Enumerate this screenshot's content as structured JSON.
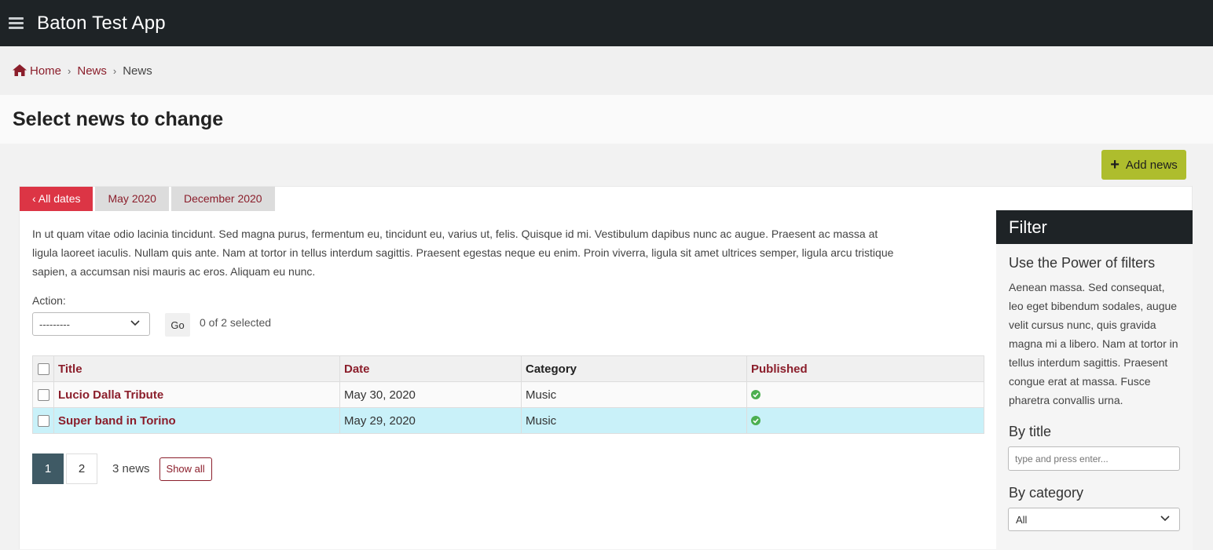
{
  "app": {
    "title": "Baton Test App"
  },
  "breadcrumbs": [
    {
      "label": "Home",
      "icon": "home-icon"
    },
    {
      "label": "News"
    },
    {
      "label": "News"
    }
  ],
  "page": {
    "title": "Select news to change"
  },
  "toolbar": {
    "add_label": "Add news"
  },
  "date_tabs": [
    {
      "label": "‹ All dates",
      "active": true
    },
    {
      "label": "May 2020",
      "active": false
    },
    {
      "label": "December 2020",
      "active": false
    }
  ],
  "description": "In ut quam vitae odio lacinia tincidunt. Sed magna purus, fermentum eu, tincidunt eu, varius ut, felis. Quisque id mi. Vestibulum dapibus nunc ac augue. Praesent ac massa at ligula laoreet iaculis. Nullam quis ante. Nam at tortor in tellus interdum sagittis. Praesent egestas neque eu enim. Proin viverra, ligula sit amet ultrices semper, ligula arcu tristique sapien, a accumsan nisi mauris ac eros. Aliquam eu nunc.",
  "actions": {
    "label": "Action:",
    "selected": "---------",
    "go_label": "Go",
    "selection_count": "0 of 2 selected"
  },
  "table": {
    "columns": [
      "Title",
      "Date",
      "Category",
      "Published"
    ],
    "rows": [
      {
        "title": "Lucio Dalla Tribute",
        "date": "May 30, 2020",
        "category": "Music",
        "published": true
      },
      {
        "title": "Super band in Torino",
        "date": "May 29, 2020",
        "category": "Music",
        "published": true
      }
    ]
  },
  "pagination": {
    "pages": [
      "1",
      "2"
    ],
    "current": "1",
    "count": "3 news",
    "show_all": "Show all"
  },
  "filter": {
    "title": "Filter",
    "subtitle": "Use the Power of filters",
    "text": "Aenean massa. Sed consequat, leo eget bibendum sodales, augue velit cursus nunc, quis gravida magna mi a libero. Nam at tortor in tellus interdum sagittis. Praesent congue erat at massa. Fusce pharetra convallis urna.",
    "by_title": {
      "label": "By title",
      "placeholder": "type and press enter..."
    },
    "by_category": {
      "label": "By category",
      "selected": "All"
    }
  },
  "colors": {
    "topbar": "#1e2326",
    "link": "#8b1e2b",
    "active_tab": "#dc3545",
    "add_button": "#aebd2d",
    "highlight_row": "#c9f1f9",
    "published_icon": "#4caf50",
    "active_page": "#3f5a65"
  }
}
